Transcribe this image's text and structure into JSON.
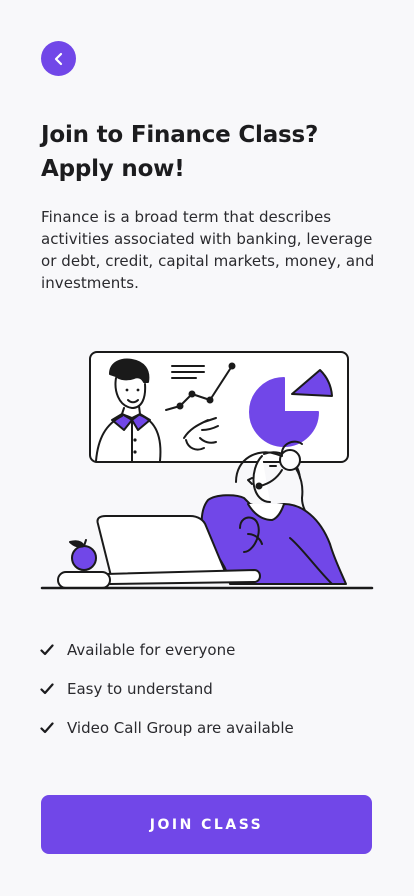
{
  "header": {
    "back_icon": "chevron-left-icon"
  },
  "main": {
    "title_line1": "Join to Finance Class?",
    "title_line2": "Apply now!",
    "description": "Finance is a broad term that describes activities associated with banking, leverage or debt, credit, capital markets, money, and investments."
  },
  "features": [
    {
      "label": "Available for everyone",
      "icon": "checkmark-icon"
    },
    {
      "label": "Easy to understand",
      "icon": "checkmark-icon"
    },
    {
      "label": "Video Call Group are available",
      "icon": "checkmark-icon"
    }
  ],
  "cta": {
    "label": "JOIN CLASS"
  },
  "colors": {
    "accent": "#7147e8",
    "background": "#f8f8fa",
    "text": "#1c1c1e"
  }
}
